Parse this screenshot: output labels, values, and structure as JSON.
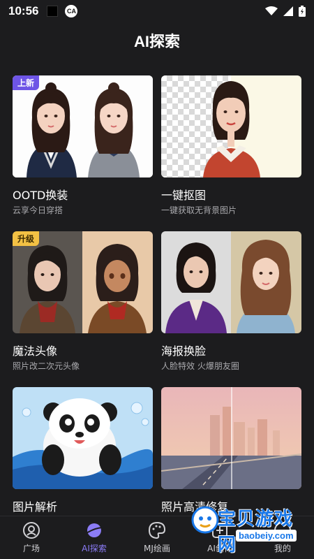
{
  "status": {
    "time": "10:56"
  },
  "page": {
    "title": "AI探索"
  },
  "cards": [
    {
      "name": "OOTD换装",
      "desc": "云享今日穿搭",
      "badge": "上新"
    },
    {
      "name": "一键抠图",
      "desc": "一键获取无背景图片"
    },
    {
      "name": "魔法头像",
      "desc": "照片改二次元头像",
      "badge": "升级"
    },
    {
      "name": "海报换脸",
      "desc": "人脸特效 火爆朋友圈"
    },
    {
      "name": "图片解析",
      "desc": ""
    },
    {
      "name": "照片高清修复",
      "desc": ""
    }
  ],
  "nav": [
    {
      "label": "广场",
      "icon": "plaza-icon"
    },
    {
      "label": "AI探索",
      "icon": "explore-planet-icon",
      "active": true
    },
    {
      "label": "MJ绘画",
      "icon": "palette-icon"
    },
    {
      "label": "AI创作",
      "icon": "create-icon"
    },
    {
      "label": "我的",
      "icon": "profile-icon"
    }
  ],
  "watermark": {
    "title": "宝贝游戏网",
    "url": "baobeiy.com"
  },
  "colors": {
    "background": "#1c1c1e",
    "accent": "#8b7cf6",
    "badge_new": "#6e55e6",
    "badge_up": "#f3c144"
  }
}
